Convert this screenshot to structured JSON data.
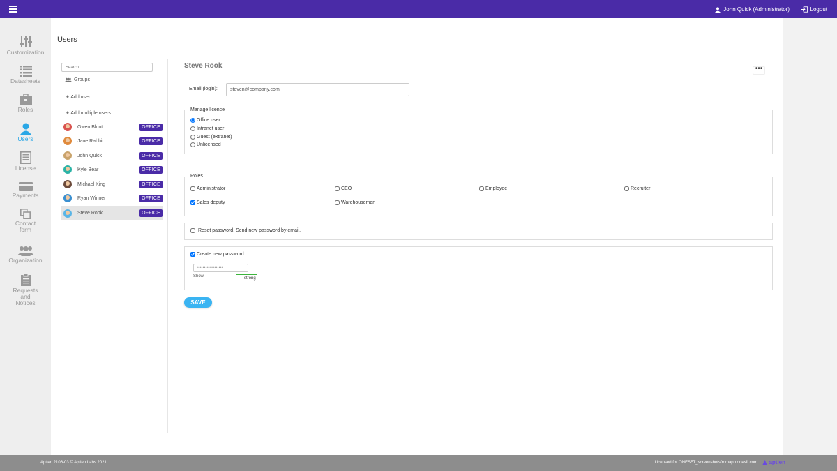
{
  "topbar": {
    "user_label": "John Quick  (Administrator)",
    "logout_label": "Logout",
    "color": "#4a2ba7"
  },
  "sidebar": {
    "items": [
      {
        "label": "Customization",
        "icon": "sliders-icon"
      },
      {
        "label": "Datasheets",
        "icon": "list-icon"
      },
      {
        "label": "Roles",
        "icon": "briefcase-icon"
      },
      {
        "label": "Users",
        "icon": "user-icon",
        "active": true
      },
      {
        "label": "License",
        "icon": "document-icon"
      },
      {
        "label": "Payments",
        "icon": "credit-card-icon"
      },
      {
        "label": "Contact form",
        "icon": "copy-icon"
      },
      {
        "label": "Organization",
        "icon": "group-icon"
      },
      {
        "label": "Requests and Notices",
        "icon": "clipboard-icon"
      }
    ]
  },
  "page": {
    "title": "Users"
  },
  "userlist": {
    "search_placeholder": "Search",
    "groups_label": "Groups",
    "add_user_label": "Add user",
    "add_multiple_label": "Add multiple users",
    "users": [
      {
        "name": "Gwen Blunt",
        "badge": "OFFICE",
        "avatar_color": "#d9534f"
      },
      {
        "name": "Jane Rabbit",
        "badge": "OFFICE",
        "avatar_color": "#e08a3c"
      },
      {
        "name": "John Quick",
        "badge": "OFFICE",
        "avatar_color": "#c9a36b"
      },
      {
        "name": "Kyle Bear",
        "badge": "OFFICE",
        "avatar_color": "#2ab3a6"
      },
      {
        "name": "Michael King",
        "badge": "OFFICE",
        "avatar_color": "#6b4a3a"
      },
      {
        "name": "Ryan Winner",
        "badge": "OFFICE",
        "avatar_color": "#3a8fd0"
      },
      {
        "name": "Steve Rook",
        "badge": "OFFICE",
        "avatar_color": "#5ab5e6",
        "selected": true
      }
    ]
  },
  "detail": {
    "name": "Steve Rook",
    "more_label": "•••",
    "email_label": "Email (login):",
    "email_value": "steven@company.com",
    "licence": {
      "legend": "Manage licence",
      "options": [
        "Office user",
        "Intranet user",
        "Guest (extranet)",
        "Unlicensed"
      ],
      "selected": "Office user"
    },
    "roles": {
      "legend": "Roles",
      "options": [
        {
          "label": "Administrator",
          "checked": false
        },
        {
          "label": "CEO",
          "checked": false
        },
        {
          "label": "Employee",
          "checked": false
        },
        {
          "label": "Recruiter",
          "checked": false
        },
        {
          "label": "Sales deputy",
          "checked": true
        },
        {
          "label": "Warehouseman",
          "checked": false
        }
      ]
    },
    "reset_label": "Reset password. Send new password by email.",
    "reset_checked": false,
    "new_password_label": "Create new password",
    "new_password_checked": true,
    "password_value": "••••••••••••••••••",
    "show_label": "Show",
    "strength_label": "strong",
    "save_label": "SAVE"
  },
  "footer": {
    "left": "Aptien 2106-03 © Aptien Labs 2021",
    "right": "Licensed for ONESFT_screenshotsfromapp.onesft.com",
    "logo": "aptien"
  }
}
